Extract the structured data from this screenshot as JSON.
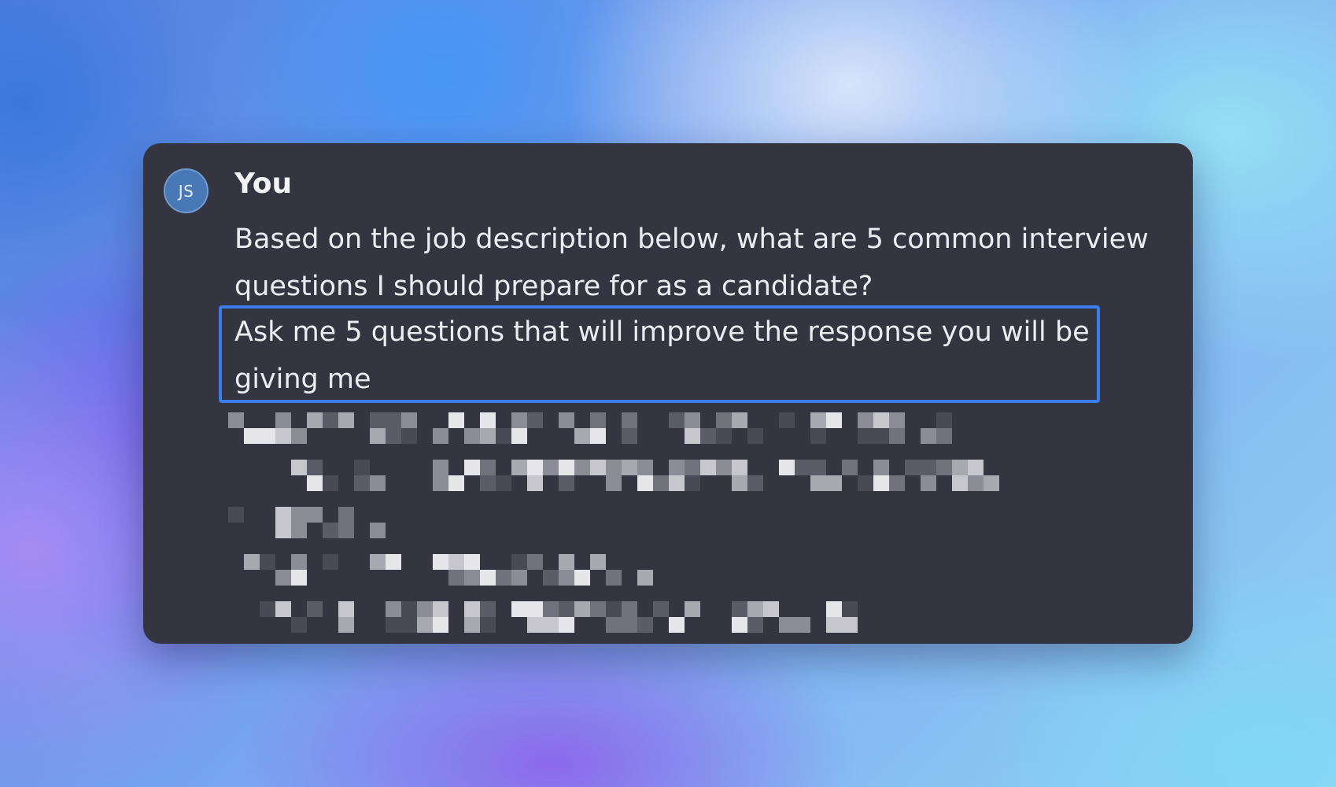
{
  "message": {
    "avatar_initials": "JS",
    "author": "You",
    "text": "Based on the job description below, what are 5 common interview questions I should prepare for as a candidate?",
    "highlighted_text": "Ask me 5 questions that will improve the response you will be giving me"
  },
  "colors": {
    "card_background": "#353541",
    "highlight_border": "#3b7cf0",
    "avatar_background": "#4878b5"
  }
}
